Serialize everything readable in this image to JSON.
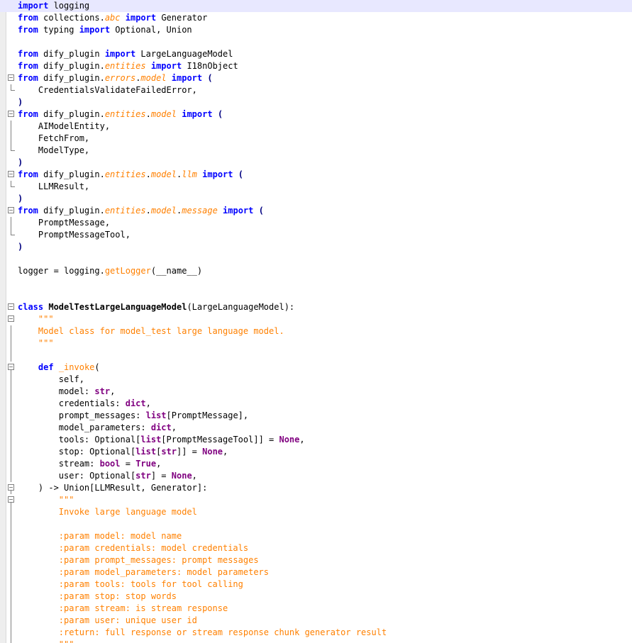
{
  "editor": {
    "language": "python",
    "current_line_color": "#e8e8ff",
    "colors": {
      "keyword": "#0000ff",
      "orange": "#ff8000",
      "builtin": "#800080",
      "operator": "#000080"
    },
    "lines": [
      [
        [
          "kw",
          "import"
        ],
        [
          "t",
          " logging"
        ]
      ],
      [
        [
          "kw",
          "from"
        ],
        [
          "t",
          " collections."
        ],
        [
          "mod",
          "abc"
        ],
        [
          "t",
          " "
        ],
        [
          "kw",
          "import"
        ],
        [
          "t",
          " Generator"
        ]
      ],
      [
        [
          "kw",
          "from"
        ],
        [
          "t",
          " typing "
        ],
        [
          "kw",
          "import"
        ],
        [
          "t",
          " Optional, Union"
        ]
      ],
      [],
      [
        [
          "kw",
          "from"
        ],
        [
          "t",
          " dify_plugin "
        ],
        [
          "kw",
          "import"
        ],
        [
          "t",
          " LargeLanguageModel"
        ]
      ],
      [
        [
          "kw",
          "from"
        ],
        [
          "t",
          " dify_plugin."
        ],
        [
          "mod",
          "entities"
        ],
        [
          "t",
          " "
        ],
        [
          "kw",
          "import"
        ],
        [
          "t",
          " I18nObject"
        ]
      ],
      [
        [
          "kw",
          "from"
        ],
        [
          "t",
          " dify_plugin."
        ],
        [
          "mod",
          "errors"
        ],
        [
          "t",
          "."
        ],
        [
          "mod",
          "model"
        ],
        [
          "t",
          " "
        ],
        [
          "kw",
          "import"
        ],
        [
          "t",
          " "
        ],
        [
          "op",
          "("
        ]
      ],
      [
        [
          "t",
          "    CredentialsValidateFailedError,"
        ]
      ],
      [
        [
          "op",
          ")"
        ]
      ],
      [
        [
          "kw",
          "from"
        ],
        [
          "t",
          " dify_plugin."
        ],
        [
          "mod",
          "entities"
        ],
        [
          "t",
          "."
        ],
        [
          "mod",
          "model"
        ],
        [
          "t",
          " "
        ],
        [
          "kw",
          "import"
        ],
        [
          "t",
          " "
        ],
        [
          "op",
          "("
        ]
      ],
      [
        [
          "t",
          "    AIModelEntity,"
        ]
      ],
      [
        [
          "t",
          "    FetchFrom,"
        ]
      ],
      [
        [
          "t",
          "    ModelType,"
        ]
      ],
      [
        [
          "op",
          ")"
        ]
      ],
      [
        [
          "kw",
          "from"
        ],
        [
          "t",
          " dify_plugin."
        ],
        [
          "mod",
          "entities"
        ],
        [
          "t",
          "."
        ],
        [
          "mod",
          "model"
        ],
        [
          "t",
          "."
        ],
        [
          "mod",
          "llm"
        ],
        [
          "t",
          " "
        ],
        [
          "kw",
          "import"
        ],
        [
          "t",
          " "
        ],
        [
          "op",
          "("
        ]
      ],
      [
        [
          "t",
          "    LLMResult,"
        ]
      ],
      [
        [
          "op",
          ")"
        ]
      ],
      [
        [
          "kw",
          "from"
        ],
        [
          "t",
          " dify_plugin."
        ],
        [
          "mod",
          "entities"
        ],
        [
          "t",
          "."
        ],
        [
          "mod",
          "model"
        ],
        [
          "t",
          "."
        ],
        [
          "mod",
          "message"
        ],
        [
          "t",
          " "
        ],
        [
          "kw",
          "import"
        ],
        [
          "t",
          " "
        ],
        [
          "op",
          "("
        ]
      ],
      [
        [
          "t",
          "    PromptMessage,"
        ]
      ],
      [
        [
          "t",
          "    PromptMessageTool,"
        ]
      ],
      [
        [
          "op",
          ")"
        ]
      ],
      [],
      [
        [
          "t",
          "logger = logging."
        ],
        [
          "fn",
          "getLogger"
        ],
        [
          "t",
          "(__name__)"
        ]
      ],
      [],
      [],
      [
        [
          "kw",
          "class"
        ],
        [
          "t",
          " "
        ],
        [
          "cls",
          "ModelTestLargeLanguageModel"
        ],
        [
          "t",
          "(LargeLanguageModel):"
        ]
      ],
      [
        [
          "str",
          "    \"\"\""
        ]
      ],
      [
        [
          "str",
          "    Model class for model_test large language model."
        ]
      ],
      [
        [
          "str",
          "    \"\"\""
        ]
      ],
      [],
      [
        [
          "t",
          "    "
        ],
        [
          "kw",
          "def"
        ],
        [
          "t",
          " "
        ],
        [
          "fn",
          "_invoke"
        ],
        [
          "t",
          "("
        ]
      ],
      [
        [
          "t",
          "        self,"
        ]
      ],
      [
        [
          "t",
          "        model: "
        ],
        [
          "bi",
          "str"
        ],
        [
          "t",
          ","
        ]
      ],
      [
        [
          "t",
          "        credentials: "
        ],
        [
          "bi",
          "dict"
        ],
        [
          "t",
          ","
        ]
      ],
      [
        [
          "t",
          "        prompt_messages: "
        ],
        [
          "bi",
          "list"
        ],
        [
          "t",
          "[PromptMessage],"
        ]
      ],
      [
        [
          "t",
          "        model_parameters: "
        ],
        [
          "bi",
          "dict"
        ],
        [
          "t",
          ","
        ]
      ],
      [
        [
          "t",
          "        tools: Optional["
        ],
        [
          "bi",
          "list"
        ],
        [
          "t",
          "[PromptMessageTool]] = "
        ],
        [
          "bi",
          "None"
        ],
        [
          "t",
          ","
        ]
      ],
      [
        [
          "t",
          "        stop: Optional["
        ],
        [
          "bi",
          "list"
        ],
        [
          "t",
          "["
        ],
        [
          "bi",
          "str"
        ],
        [
          "t",
          "]] = "
        ],
        [
          "bi",
          "None"
        ],
        [
          "t",
          ","
        ]
      ],
      [
        [
          "t",
          "        stream: "
        ],
        [
          "bi",
          "bool"
        ],
        [
          "t",
          " = "
        ],
        [
          "bi",
          "True"
        ],
        [
          "t",
          ","
        ]
      ],
      [
        [
          "t",
          "        user: Optional["
        ],
        [
          "bi",
          "str"
        ],
        [
          "t",
          "] = "
        ],
        [
          "bi",
          "None"
        ],
        [
          "t",
          ","
        ]
      ],
      [
        [
          "t",
          "    ) -> Union[LLMResult, Generator]:"
        ]
      ],
      [
        [
          "str",
          "        \"\"\""
        ]
      ],
      [
        [
          "str",
          "        Invoke large language model"
        ]
      ],
      [],
      [
        [
          "str",
          "        :param model: model name"
        ]
      ],
      [
        [
          "str",
          "        :param credentials: model credentials"
        ]
      ],
      [
        [
          "str",
          "        :param prompt_messages: prompt messages"
        ]
      ],
      [
        [
          "str",
          "        :param model_parameters: model parameters"
        ]
      ],
      [
        [
          "str",
          "        :param tools: tools for tool calling"
        ]
      ],
      [
        [
          "str",
          "        :param stop: stop words"
        ]
      ],
      [
        [
          "str",
          "        :param stream: is stream response"
        ]
      ],
      [
        [
          "str",
          "        :param user: unique user id"
        ]
      ],
      [
        [
          "str",
          "        :return: full response or stream response chunk generator result"
        ]
      ],
      [
        [
          "str",
          "        \"\"\""
        ]
      ]
    ]
  }
}
